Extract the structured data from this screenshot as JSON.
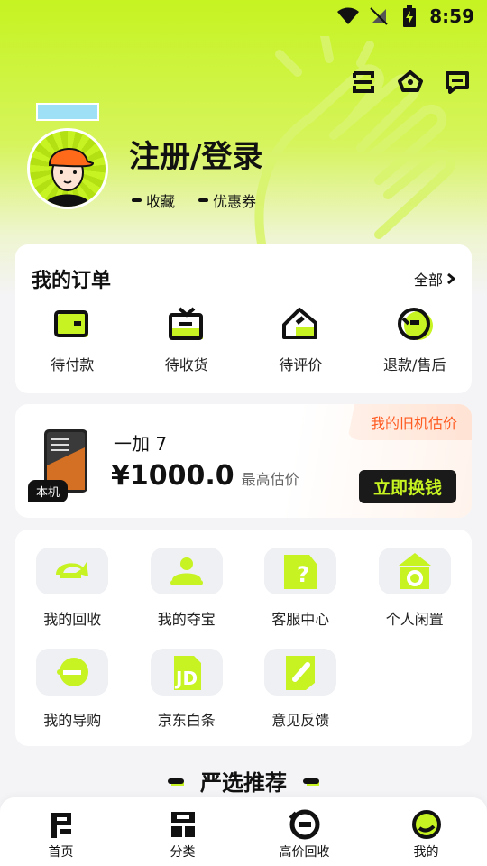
{
  "status_bar": {
    "time": "8:59"
  },
  "profile": {
    "login_label": "注册/登录",
    "links": [
      {
        "label": "收藏"
      },
      {
        "label": "优惠券"
      }
    ]
  },
  "orders": {
    "title": "我的订单",
    "all_label": "全部",
    "items": [
      {
        "label": "待付款",
        "icon": "wallet-icon"
      },
      {
        "label": "待收货",
        "icon": "tv-box-icon"
      },
      {
        "label": "待评价",
        "icon": "tag-icon"
      },
      {
        "label": "退款/售后",
        "icon": "refund-icon"
      }
    ]
  },
  "trade_in": {
    "banner": "我的旧机估价",
    "device_tag": "本机",
    "device_name": "一加 7",
    "price": "¥1000.0",
    "price_note": "最高估价",
    "button": "立即换钱"
  },
  "services": [
    {
      "label": "我的回收",
      "icon": "recycle-icon"
    },
    {
      "label": "我的夺宝",
      "icon": "treasure-icon"
    },
    {
      "label": "客服中心",
      "icon": "help-icon"
    },
    {
      "label": "个人闲置",
      "icon": "idle-icon"
    },
    {
      "label": "我的导购",
      "icon": "guide-icon"
    },
    {
      "label": "京东白条",
      "icon": "jd-icon"
    },
    {
      "label": "意见反馈",
      "icon": "feedback-icon"
    }
  ],
  "recommend": {
    "title": "严选推荐"
  },
  "tabbar": [
    {
      "label": "首页",
      "icon": "home-icon"
    },
    {
      "label": "分类",
      "icon": "category-icon"
    },
    {
      "label": "高价回收",
      "icon": "recycle-tab-icon"
    },
    {
      "label": "我的",
      "icon": "profile-tab-icon"
    }
  ],
  "colors": {
    "accent": "#c6f321",
    "dark": "#111111",
    "orange": "#ff5a1f"
  }
}
